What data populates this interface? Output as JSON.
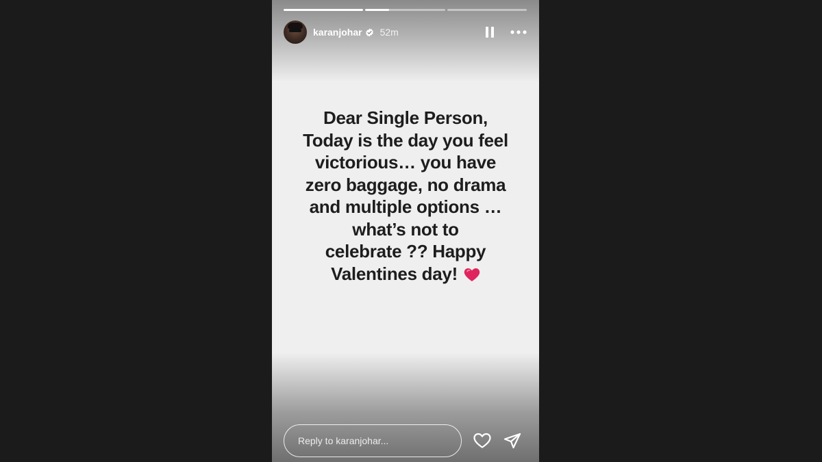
{
  "story": {
    "progress": [
      {
        "fill": 1.0
      },
      {
        "fill": 0.3
      },
      {
        "fill": 0.0
      }
    ],
    "header": {
      "username": "karanjohar",
      "verified_icon": "verified-badge-icon",
      "timestamp": "52m",
      "pause_icon": "pause-icon",
      "more_icon": "more-options-icon"
    },
    "message": {
      "lines": [
        "Dear Single Person,",
        "Today is the day you feel",
        "victorious… you have",
        "zero baggage, no drama",
        "and multiple options …",
        "what’s not to",
        "celebrate ?? Happy",
        "Valentines day!"
      ],
      "emoji": "red-heart-emoji"
    },
    "footer": {
      "reply_placeholder": "Reply to karanjohar...",
      "like_icon": "heart-outline-icon",
      "share_icon": "send-icon"
    }
  },
  "colors": {
    "page_background": "#1b1b1b",
    "story_background": "#efefef",
    "text": "#1d1d1d",
    "heart": "#e0245e"
  }
}
